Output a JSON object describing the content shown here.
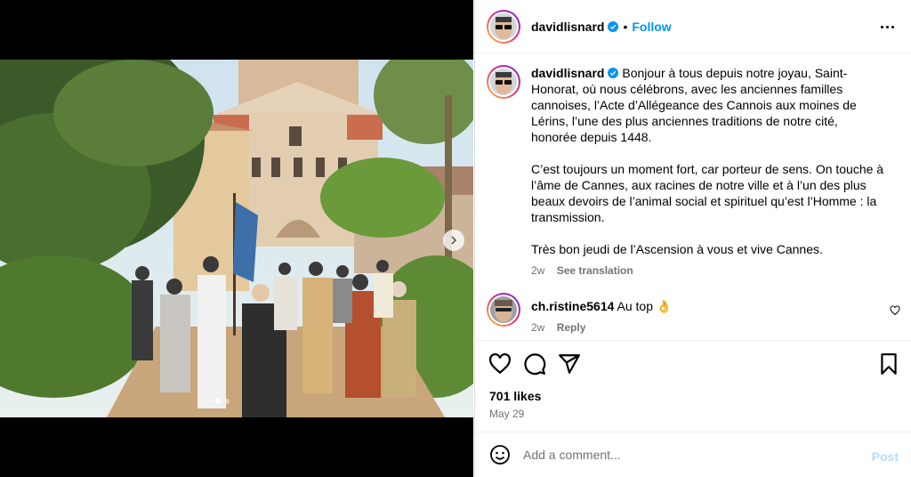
{
  "post": {
    "username": "davidlisnard",
    "follow_label": "Follow",
    "dot": "•",
    "caption_paragraphs": [
      "Bonjour à tous depuis notre joyau, Saint-Honorat, où nous célébrons, avec les anciennes familles cannoises, l’Acte d’Allégeance des Cannois aux moines de Lérins, l’une des plus anciennes traditions de notre cité, honorée depuis 1448.",
      "C’est toujours un moment fort, car porteur de sens. On touche à l’âme de Cannes, aux racines de notre ville et à l’un des plus beaux devoirs de l’animal social et spirituel qu’est l’Homme : la transmission.",
      "Très bon jeudi de l’Ascension à vous et vive Cannes."
    ],
    "caption_age": "2w",
    "see_translation": "See translation",
    "likes": "701 likes",
    "date": "May 29"
  },
  "comment": {
    "username": "ch.ristine5614",
    "text": "Au top 👌",
    "age": "2w",
    "reply": "Reply"
  },
  "add_comment": {
    "placeholder": "Add a comment...",
    "post_label": "Post"
  },
  "icons": {
    "verified": "verified-badge-icon",
    "more": "more-options-icon",
    "like": "heart-icon",
    "comment": "comment-icon",
    "share": "share-icon",
    "save": "bookmark-icon",
    "emoji": "emoji-icon",
    "next": "chevron-right-icon"
  },
  "colors": {
    "link": "#0095f6",
    "muted": "#737373",
    "post_disabled": "#b2dffc"
  },
  "carousel": {
    "slides": 2,
    "active": 1
  }
}
